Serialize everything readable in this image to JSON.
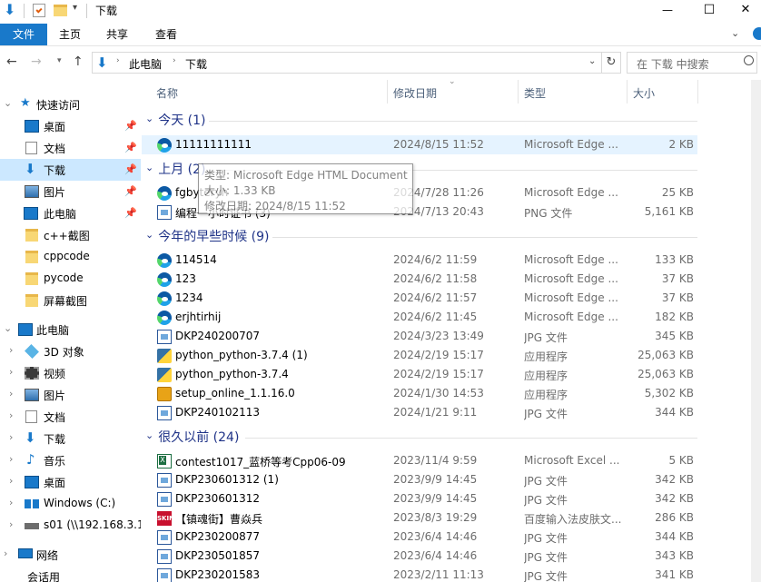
{
  "window": {
    "title": "下载",
    "minimize_glyph": "—",
    "maximize_glyph": "☐",
    "close_glyph": "✕"
  },
  "ribbon": {
    "tabs": [
      "文件",
      "主页",
      "共享",
      "查看"
    ],
    "accent": "#1979ca"
  },
  "address": {
    "path": [
      "此电脑",
      "下载"
    ],
    "search_placeholder": "在 下载 中搜索"
  },
  "nav": {
    "quick_access": "快速访问",
    "items": [
      {
        "label": "桌面",
        "icon": "desktop-icon",
        "pinned": true
      },
      {
        "label": "文档",
        "icon": "documents-icon",
        "pinned": true
      },
      {
        "label": "下载",
        "icon": "download-icon",
        "pinned": true,
        "selected": true
      },
      {
        "label": "图片",
        "icon": "pictures-icon",
        "pinned": true
      },
      {
        "label": "此电脑",
        "icon": "pc-icon",
        "pinned": true
      },
      {
        "label": "c++截图",
        "icon": "folder-icon"
      },
      {
        "label": "cppcode",
        "icon": "folder-icon"
      },
      {
        "label": "pycode",
        "icon": "folder-icon"
      },
      {
        "label": "屏幕截图",
        "icon": "folder-icon"
      }
    ],
    "this_pc": "此电脑",
    "pc_items": [
      {
        "label": "3D 对象",
        "icon": "3d-objects-icon"
      },
      {
        "label": "视频",
        "icon": "videos-icon"
      },
      {
        "label": "图片",
        "icon": "pictures-icon"
      },
      {
        "label": "文档",
        "icon": "documents-icon"
      },
      {
        "label": "下载",
        "icon": "download-icon"
      },
      {
        "label": "音乐",
        "icon": "music-icon"
      },
      {
        "label": "桌面",
        "icon": "desktop-icon"
      },
      {
        "label": "Windows  (C:)",
        "icon": "drive-icon"
      },
      {
        "label": "s01 (\\\\192.168.3.1",
        "icon": "network-drive-icon"
      }
    ],
    "network": "网络",
    "last": "会话用"
  },
  "columns": [
    "名称",
    "修改日期",
    "类型",
    "大小"
  ],
  "groups": [
    {
      "title": "今天 (1)",
      "files": [
        {
          "name": "11111111111",
          "date": "2024/8/15 11:52",
          "type": "Microsoft Edge ...",
          "size": "2 KB",
          "icon": "edge"
        }
      ]
    },
    {
      "title": "上月 (2)",
      "files": [
        {
          "name": "fgbyteryh",
          "date": "2024/7/28 11:26",
          "type": "Microsoft Edge ...",
          "size": "25 KB",
          "icon": "edge"
        },
        {
          "name": "编程一小时证书 (3)",
          "date": "2024/7/13 20:43",
          "type": "PNG 文件",
          "size": "5,161 KB",
          "icon": "doc"
        }
      ]
    },
    {
      "title": "今年的早些时候 (9)",
      "files": [
        {
          "name": "114514",
          "date": "2024/6/2 11:59",
          "type": "Microsoft Edge ...",
          "size": "133 KB",
          "icon": "edge"
        },
        {
          "name": "123",
          "date": "2024/6/2 11:58",
          "type": "Microsoft Edge ...",
          "size": "37 KB",
          "icon": "edge"
        },
        {
          "name": "1234",
          "date": "2024/6/2 11:57",
          "type": "Microsoft Edge ...",
          "size": "37 KB",
          "icon": "edge"
        },
        {
          "name": "erjhtirhij",
          "date": "2024/6/2 11:45",
          "type": "Microsoft Edge ...",
          "size": "182 KB",
          "icon": "edge"
        },
        {
          "name": "DKP240200707",
          "date": "2024/3/23 13:49",
          "type": "JPG 文件",
          "size": "345 KB",
          "icon": "doc"
        },
        {
          "name": "python_python-3.7.4 (1)",
          "date": "2024/2/19 15:17",
          "type": "应用程序",
          "size": "25,063 KB",
          "icon": "exe"
        },
        {
          "name": "python_python-3.7.4",
          "date": "2024/2/19 15:17",
          "type": "应用程序",
          "size": "25,063 KB",
          "icon": "exe"
        },
        {
          "name": "setup_online_1.1.16.0",
          "date": "2024/1/30 14:53",
          "type": "应用程序",
          "size": "5,302 KB",
          "icon": "setup"
        },
        {
          "name": "DKP240102113",
          "date": "2024/1/21 9:11",
          "type": "JPG 文件",
          "size": "344 KB",
          "icon": "doc"
        }
      ]
    },
    {
      "title": "很久以前 (24)",
      "files": [
        {
          "name": "contest1017_蓝桥等考Cpp06-09",
          "date": "2023/11/4 9:59",
          "type": "Microsoft Excel ...",
          "size": "5 KB",
          "icon": "xls"
        },
        {
          "name": "DKP230601312 (1)",
          "date": "2023/9/9 14:45",
          "type": "JPG 文件",
          "size": "342 KB",
          "icon": "doc"
        },
        {
          "name": "DKP230601312",
          "date": "2023/9/9 14:45",
          "type": "JPG 文件",
          "size": "342 KB",
          "icon": "doc"
        },
        {
          "name": "【镇魂街】曹焱兵",
          "date": "2023/8/3 19:29",
          "type": "百度输入法皮肤文...",
          "size": "286 KB",
          "icon": "skin"
        },
        {
          "name": "DKP230200877",
          "date": "2023/6/4 14:46",
          "type": "JPG 文件",
          "size": "344 KB",
          "icon": "doc"
        },
        {
          "name": "DKP230501857",
          "date": "2023/6/4 14:46",
          "type": "JPG 文件",
          "size": "343 KB",
          "icon": "doc"
        },
        {
          "name": "DKP230201583",
          "date": "2023/2/11 11:13",
          "type": "JPG 文件",
          "size": "341 KB",
          "icon": "doc"
        }
      ]
    }
  ],
  "tooltip": {
    "line1": "类型: Microsoft Edge HTML Document",
    "line2": "大小: 1.33 KB",
    "line3": "修改日期: 2024/8/15 11:52"
  }
}
